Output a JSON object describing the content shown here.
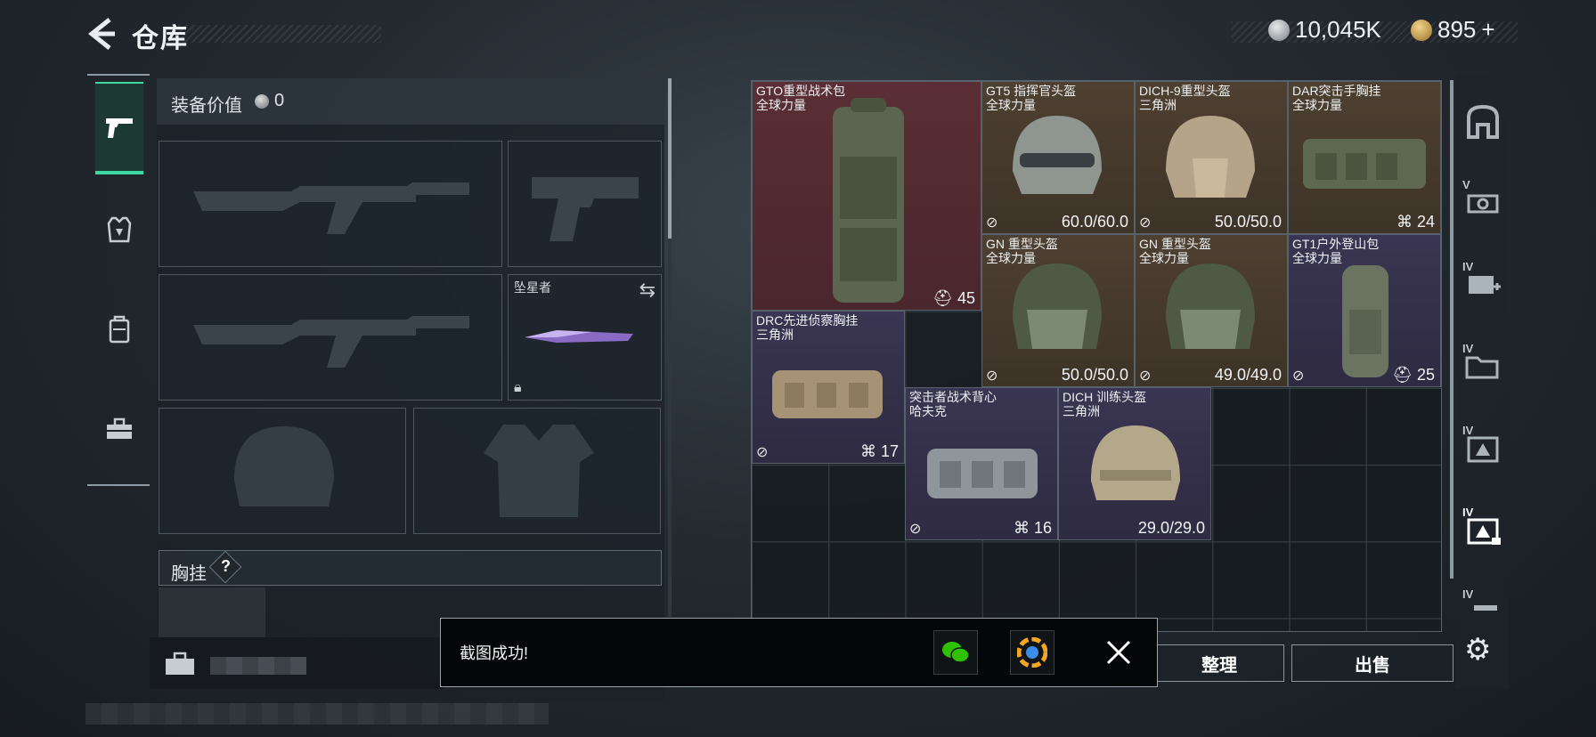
{
  "header": {
    "title": "仓库",
    "silver_amount": "10,045K",
    "gold_amount": "895",
    "gold_add": "+"
  },
  "equipment": {
    "value_label": "装备价值",
    "value": "0",
    "melee_slot_name": "坠星者",
    "rig_label": "胸挂",
    "help_mark": "?"
  },
  "items": [
    {
      "name": "GTO重型战术包",
      "sub": "全球力量",
      "value": "45",
      "rarity": "red"
    },
    {
      "name": "GT5 指挥官头盔",
      "sub": "全球力量",
      "value": "60.0/60.0",
      "rarity": "gold"
    },
    {
      "name": "DICH-9重型头盔",
      "sub": "三角洲",
      "value": "50.0/50.0",
      "rarity": "gold"
    },
    {
      "name": "DAR突击手胸挂",
      "sub": "全球力量",
      "value": "24",
      "rarity": "gold"
    },
    {
      "name": "GN 重型头盔",
      "sub": "全球力量",
      "value": "50.0/50.0",
      "rarity": "gold"
    },
    {
      "name": "GN 重型头盔",
      "sub": "全球力量",
      "value": "49.0/49.0",
      "rarity": "gold"
    },
    {
      "name": "GT1户外登山包",
      "sub": "全球力量",
      "value": "25",
      "rarity": "purple"
    },
    {
      "name": "DRC先进侦察胸挂",
      "sub": "三角洲",
      "value": "17",
      "rarity": "purple"
    },
    {
      "name": "突击者战术背心",
      "sub": "哈夫克",
      "value": "16",
      "rarity": "purple"
    },
    {
      "name": "DICH 训练头盔",
      "sub": "三角洲",
      "value": "29.0/29.0",
      "rarity": "purple"
    }
  ],
  "side_toolbar": {
    "level_labels": [
      "V",
      "IV",
      "IV",
      "IV",
      "IV",
      "IV"
    ]
  },
  "buttons": {
    "organize": "整理",
    "sell": "出售"
  },
  "toast": {
    "message": "截图成功!"
  },
  "colors": {
    "accent_green": "#3fd7a2",
    "rarity_red": "#5a2e34",
    "rarity_gold": "#4e4031",
    "rarity_purple": "#3a3552"
  }
}
